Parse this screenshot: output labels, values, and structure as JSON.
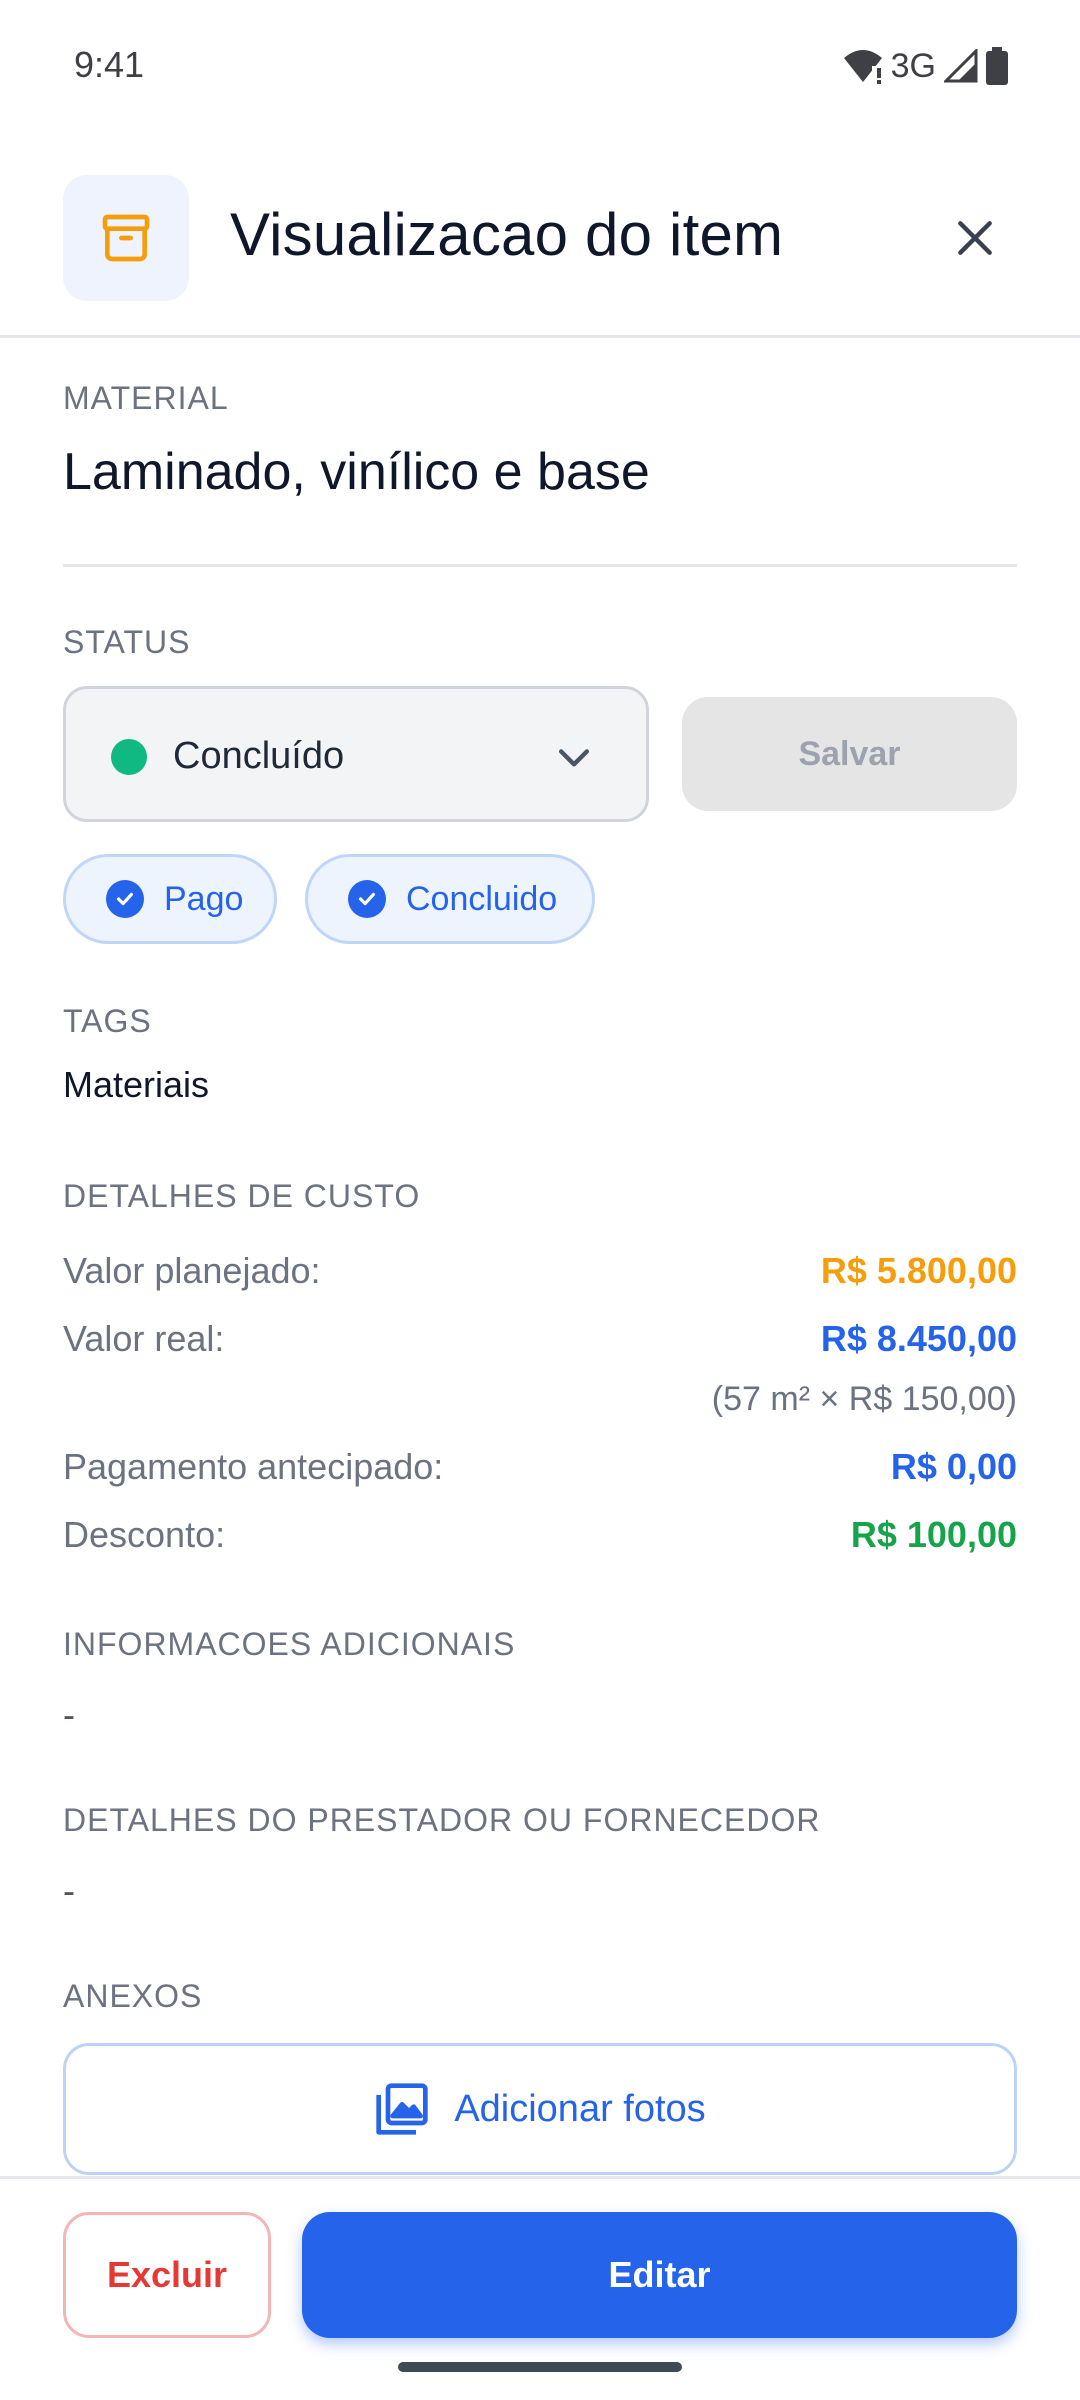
{
  "status_bar": {
    "time": "9:41",
    "network": "3G"
  },
  "header": {
    "title": "Visualizacao do item",
    "icon": "archive-box-icon",
    "close_icon": "close-icon"
  },
  "material": {
    "label": "MATERIAL",
    "value": "Laminado, vinílico e base"
  },
  "status": {
    "label": "STATUS",
    "selected": "Concluído",
    "indicator_color": "#10b981",
    "save_label": "Salvar",
    "chips": [
      {
        "label": "Pago"
      },
      {
        "label": "Concluido"
      }
    ]
  },
  "tags": {
    "label": "TAGS",
    "value": "Materiais"
  },
  "cost": {
    "label": "DETALHES DE CUSTO",
    "rows": [
      {
        "key": "Valor planejado:",
        "value": "R$ 5.800,00",
        "color": "#f59e0b"
      },
      {
        "key": "Valor real:",
        "value": "R$ 8.450,00",
        "color": "#2563eb"
      },
      {
        "key": "Pagamento antecipado:",
        "value": "R$ 0,00",
        "color": "#2563eb"
      },
      {
        "key": "Desconto:",
        "value": "R$ 100,00",
        "color": "#16a34a"
      }
    ],
    "note": "(57 m² × R$ 150,00)"
  },
  "additional_info": {
    "label": "INFORMACOES ADICIONAIS",
    "value": "-"
  },
  "provider": {
    "label": "DETALHES DO PRESTADOR OU FORNECEDOR",
    "value": "-"
  },
  "attachments": {
    "label": "ANEXOS",
    "add_photos_label": "Adicionar fotos"
  },
  "footer": {
    "delete_label": "Excluir",
    "edit_label": "Editar"
  }
}
